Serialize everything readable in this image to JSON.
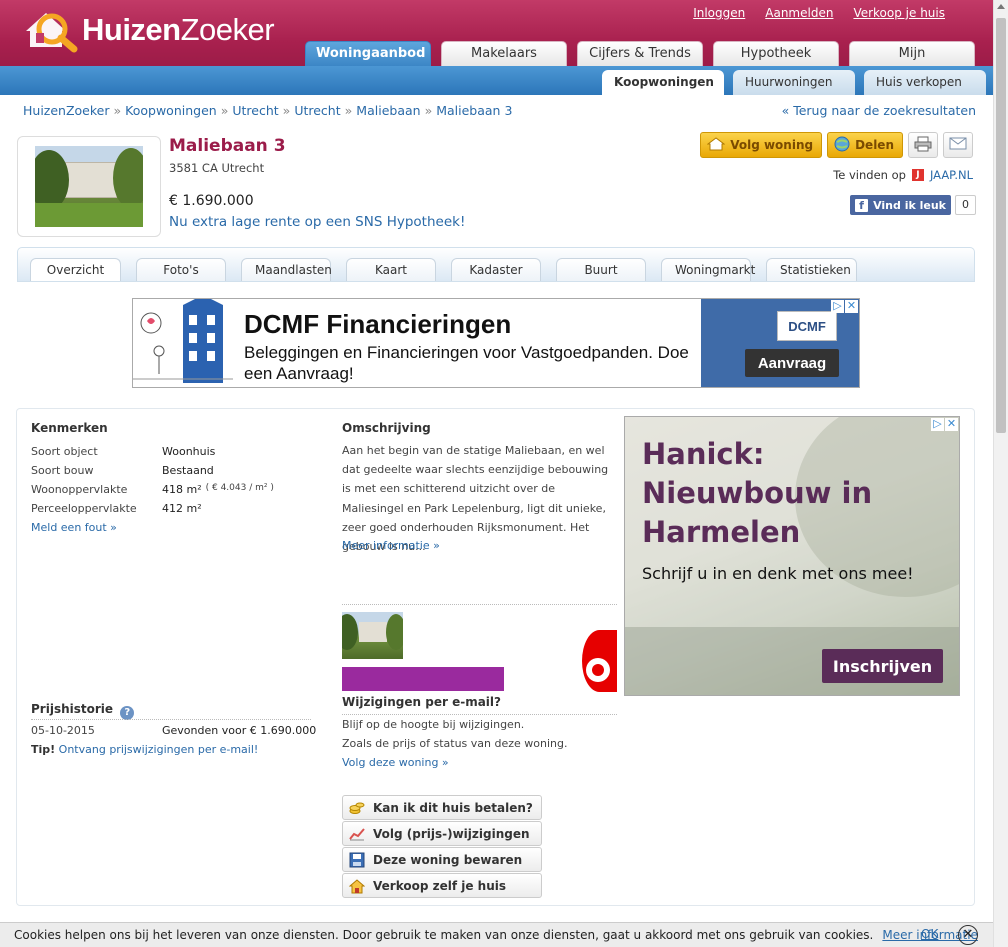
{
  "brand": {
    "logo_part1": "Huizen",
    "logo_part2": "Zoeker"
  },
  "top_links": [
    "Inloggen",
    "Aanmelden",
    "Verkoop je huis"
  ],
  "main_tabs": [
    "Woningaanbod",
    "Makelaars",
    "Cijfers & Trends",
    "Hypotheek",
    "Mijn HuizenZoeker"
  ],
  "sub_tabs": [
    "Koopwoningen",
    "Huurwoningen",
    "Huis verkopen"
  ],
  "breadcrumb": [
    "HuizenZoeker",
    "Koopwoningen",
    "Utrecht",
    "Utrecht",
    "Maliebaan",
    "Maliebaan 3"
  ],
  "breadcrumb_sep": "»",
  "back_link": "« Terug naar de zoekresultaten",
  "property": {
    "title": "Maliebaan 3",
    "address": "3581 CA Utrecht",
    "price": "€ 1.690.000",
    "promo": "Nu extra lage rente op een SNS Hypotheek!"
  },
  "actions": {
    "follow": "Volg woning",
    "share": "Delen",
    "te_vinden": "Te vinden op",
    "jaap": "JAAP.NL",
    "fb_like": "Vind ik leuk",
    "fb_count": "0"
  },
  "detail_tabs": [
    "Overzicht",
    "Foto's",
    "Maandlasten",
    "Kaart",
    "Kadaster",
    "Buurt",
    "Woningmarkt",
    "Statistieken"
  ],
  "banner_ad": {
    "title": "DCMF Financieringen",
    "text": "Beleggingen en Financieringen voor Vastgoedpanden. Doe een Aanvraag!",
    "logo": "DCMF",
    "button": "Aanvraag"
  },
  "kenmerken": {
    "title": "Kenmerken",
    "rows": [
      {
        "k": "Soort object",
        "v": "Woonhuis",
        "extra": ""
      },
      {
        "k": "Soort bouw",
        "v": "Bestaand",
        "extra": ""
      },
      {
        "k": "Woonoppervlakte",
        "v": "418 m²",
        "extra": "( € 4.043 / m² )"
      },
      {
        "k": "Perceeloppervlakte",
        "v": "412 m²",
        "extra": ""
      }
    ],
    "link": "Meld een fout »"
  },
  "omschrijving": {
    "title": "Omschrijving",
    "text": "Aan het begin van de statige Maliebaan, en wel dat gedeelte waar slechts eenzijdige bebouwing is met een schitterend uitzicht over de Maliesingel en Park Lepelenburg, ligt dit unieke, zeer goed onderhouden Rijksmonument. Het gebouw is nu...",
    "link": "Meer informatie »"
  },
  "prijshistorie": {
    "title": "Prijshistorie",
    "date": "05-10-2015",
    "entry": "Gevonden voor € 1.690.000",
    "tip_label": "Tip!",
    "tip_link": "Ontvang prijswijzigingen per e-mail!"
  },
  "email": {
    "title": "Wijzigingen per e-mail?",
    "line1": "Blijf op de hoogte bij wijzigingen.",
    "line2": "Zoals de prijs of status van deze woning.",
    "link": "Volg deze woning »"
  },
  "action_buttons": [
    "Kan ik dit huis betalen?",
    "Volg (prijs-)wijzigingen",
    "Deze woning bewaren",
    "Verkoop zelf je huis"
  ],
  "side_ad": {
    "title": "Hanick: Nieuwbouw in Harmelen",
    "text": "Schrijf u in en denk met ons mee!",
    "button": "Inschrijven"
  },
  "cookie": {
    "text": "Cookies helpen ons bij het leveren van onze diensten. Door gebruik te maken van onze diensten, gaat u akkoord met ons gebruik van cookies.",
    "more": "Meer informatie",
    "ok": "OK",
    "close": "✕"
  }
}
